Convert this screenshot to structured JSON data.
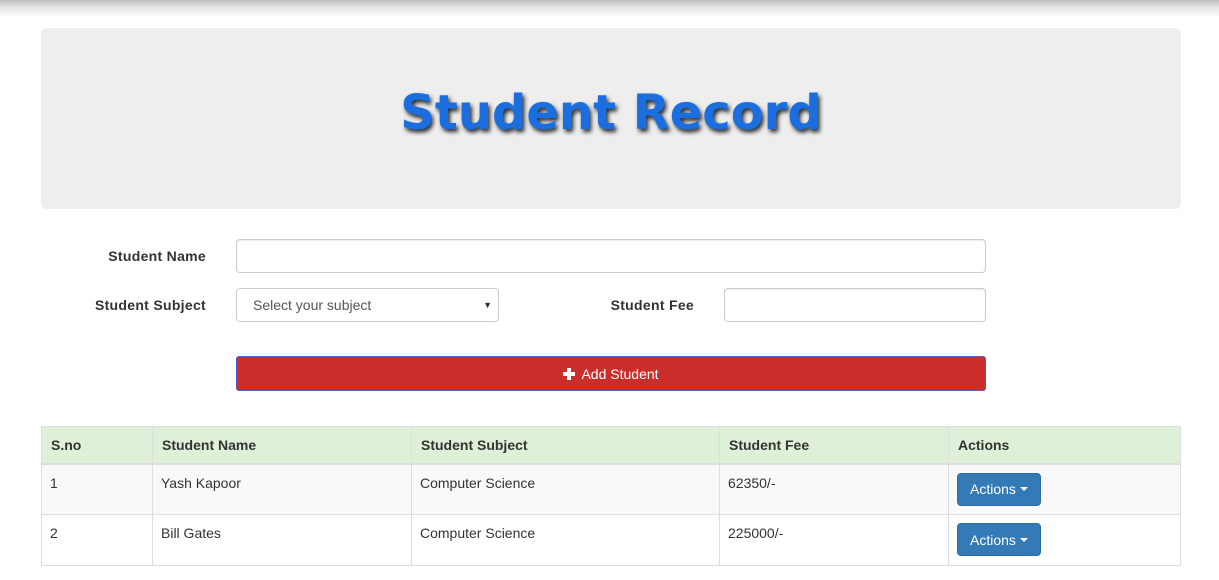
{
  "header": {
    "title": "Student Record"
  },
  "form": {
    "name_label": "Student Name",
    "name_value": "",
    "subject_label": "Student Subject",
    "subject_selected": "Select your subject",
    "fee_label": "Student Fee",
    "fee_value": "",
    "add_button_label": "Add Student"
  },
  "table": {
    "headers": [
      "S.no",
      "Student Name",
      "Student Subject",
      "Student Fee",
      "Actions"
    ],
    "rows": [
      {
        "sno": "1",
        "name": "Yash Kapoor",
        "subject": "Computer Science",
        "fee": "62350/-",
        "action_label": "Actions"
      },
      {
        "sno": "2",
        "name": "Bill Gates",
        "subject": "Computer Science",
        "fee": "225000/-",
        "action_label": "Actions"
      }
    ]
  },
  "colors": {
    "title": "#1a6ee0",
    "add_button": "#cb2d2a",
    "actions_button": "#337ab7",
    "table_header": "#dff0d8"
  },
  "icons": {
    "add_button_icon": "plus-icon",
    "select_caret": "caret-down-icon",
    "actions_caret": "caret-down-icon"
  }
}
